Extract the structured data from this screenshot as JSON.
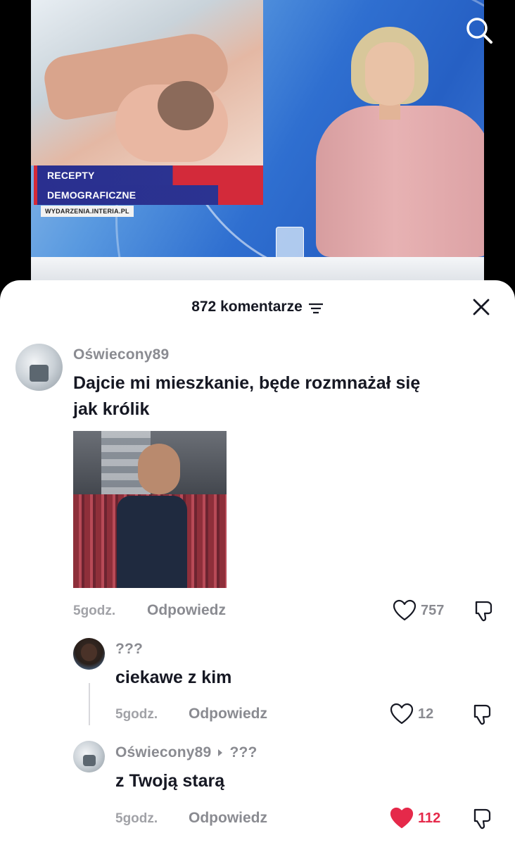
{
  "video": {
    "lower_third": {
      "line1": "RECEPTY",
      "line2": "DEMOGRAFICZNE",
      "source": "WYDARZENIA.INTERIA.PL"
    },
    "search_icon": "search-icon"
  },
  "sheet": {
    "title": "872 komentarze",
    "filter_icon": "filter-icon",
    "close_icon": "close-icon"
  },
  "comments": [
    {
      "username": "Oświecony89",
      "text_line1": "Dajcie mi mieszkanie, będe rozmnażał się",
      "text_line2": "jak królik",
      "has_image": true,
      "time": "5godz.",
      "reply_label": "Odpowiedz",
      "likes": "757",
      "liked": false
    },
    {
      "username": "???",
      "text": "ciekawe z kim",
      "time": "5godz.",
      "reply_label": "Odpowiedz",
      "likes": "12",
      "liked": false
    },
    {
      "username": "Oświecony89",
      "reply_to": "???",
      "text": "z Twoją starą",
      "time": "5godz.",
      "reply_label": "Odpowiedz",
      "likes": "112",
      "liked": true
    }
  ],
  "colors": {
    "text_primary": "#161823",
    "text_secondary": "#8a8b91",
    "like_active": "#e5294a"
  }
}
